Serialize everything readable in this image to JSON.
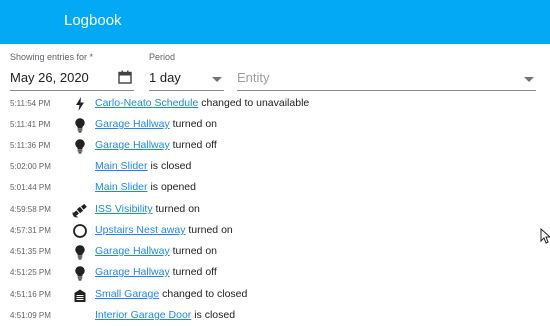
{
  "header": {
    "title": "Logbook",
    "color": "#03a9f4"
  },
  "filters": {
    "date_label": "Showing entries for *",
    "date_value": "May 26, 2020",
    "period_label": "Period",
    "period_value": "1 day",
    "entity_placeholder": "Entity"
  },
  "entries": [
    {
      "time": "5:11:54 PM",
      "icon": "lightning-icon",
      "name": "Carlo-Neato Schedule",
      "action": "changed to unavailable"
    },
    {
      "time": "5:11:41 PM",
      "icon": "lightbulb-icon",
      "name": "Garage Hallway",
      "action": "turned on"
    },
    {
      "time": "5:11:36 PM",
      "icon": "lightbulb-icon",
      "name": "Garage Hallway",
      "action": "turned off"
    },
    {
      "time": "5:02:00 PM",
      "icon": "",
      "name": "Main Slider",
      "action": "is closed"
    },
    {
      "time": "5:01:44 PM",
      "icon": "",
      "name": "Main Slider",
      "action": "is opened"
    },
    {
      "time": "4:59:58 PM",
      "icon": "satellite-icon",
      "name": "ISS Visibility",
      "action": "turned on"
    },
    {
      "time": "4:57:31 PM",
      "icon": "circle-outline-icon",
      "name": "Upstairs Nest away",
      "action": "turned on"
    },
    {
      "time": "4:51:35 PM",
      "icon": "lightbulb-icon",
      "name": "Garage Hallway",
      "action": "turned on"
    },
    {
      "time": "4:51:25 PM",
      "icon": "lightbulb-icon",
      "name": "Garage Hallway",
      "action": "turned off"
    },
    {
      "time": "4:51:16 PM",
      "icon": "garage-icon",
      "name": "Small Garage",
      "action": "changed to closed"
    },
    {
      "time": "4:51:09 PM",
      "icon": "",
      "name": "Interior Garage Door",
      "action": "is closed"
    }
  ]
}
